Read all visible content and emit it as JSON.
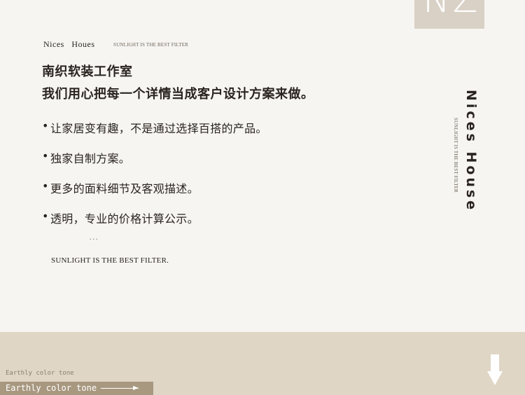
{
  "logo": {
    "text": "NZ"
  },
  "brand": {
    "name": "Nices   Houes",
    "tagline": "SUNLIGHT IS THE BEST FILTER"
  },
  "headings": [
    "南织软装工作室",
    "我们用心把每一个详情当成客户设计方案来做。"
  ],
  "bullets": [
    "让家居变有趣，不是通过选择百搭的产品。",
    "独家自制方案。",
    "更多的面料细节及客观描述。",
    "透明，专业的价格计算公示。"
  ],
  "bullet_marker": "•",
  "ellipsis": "...",
  "tagline": "SUNLIGHT IS THE BEST FILTER.",
  "side": {
    "title": "Nices House",
    "tagline": "SUNLIGHT IS THE BEST FILTER"
  },
  "footer": {
    "small_label": "Earthly color tone",
    "bar_label": "Earthly color tone"
  },
  "colors": {
    "background": "#f7f5f1",
    "footer": "#e0d6c5",
    "footer_bar": "#a89880",
    "logo_box": "#d9d1c6"
  },
  "icons": {
    "footer_arrow": "right-arrow-icon",
    "scroll_down": "down-arrow-icon"
  }
}
